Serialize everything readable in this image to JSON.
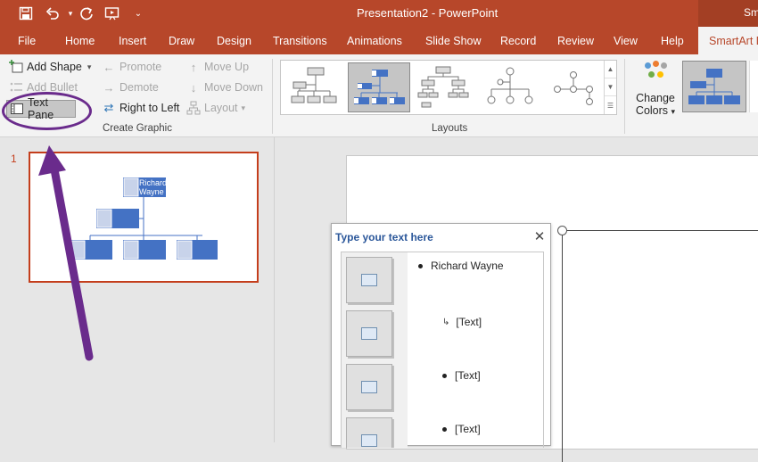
{
  "window": {
    "title": "Presentation2  -  PowerPoint",
    "title_right_partial": "Sm",
    "save_icon": "save-icon",
    "undo_icon": "undo-icon",
    "redo_icon": "redo-icon",
    "present_icon": "present-from-beginning-icon"
  },
  "tabs": [
    "File",
    "Home",
    "Insert",
    "Draw",
    "Design",
    "Transitions",
    "Animations",
    "Slide Show",
    "Record",
    "Review",
    "View",
    "Help"
  ],
  "active_tab": "SmartArt D",
  "ribbon": {
    "create_graphic": {
      "add_shape": "Add Shape",
      "add_bullet": "Add Bullet",
      "text_pane": "Text Pane",
      "promote": "Promote",
      "demote": "Demote",
      "right_to_left": "Right to Left",
      "move_up": "Move Up",
      "move_down": "Move Down",
      "layout": "Layout",
      "label": "Create Graphic"
    },
    "layouts": {
      "label": "Layouts"
    },
    "change_colors": {
      "line1": "Change",
      "line2": "Colors"
    }
  },
  "thumbnail": {
    "slide_number": "1",
    "root_name_line1": "Richard",
    "root_name_line2": "Wayne"
  },
  "text_pane": {
    "title": "Type your text here",
    "items": [
      {
        "text": "Richard Wayne",
        "level": 1
      },
      {
        "text": "[Text]",
        "level": 2
      },
      {
        "text": "[Text]",
        "level": 1
      },
      {
        "text": "[Text]",
        "level": 1
      }
    ]
  },
  "colors": {
    "accent": "#b7472a",
    "annotation": "#6a2b8c",
    "smartart_blue": "#4472c4"
  }
}
